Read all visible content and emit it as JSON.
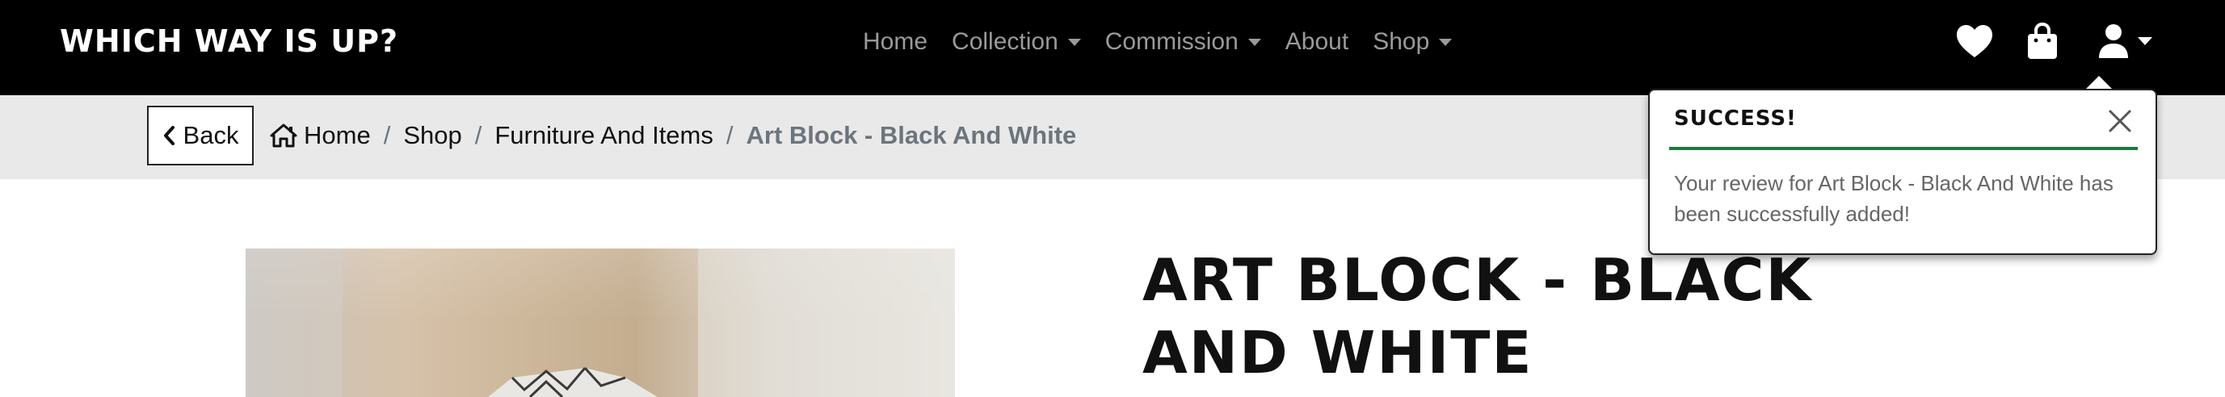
{
  "brand": "WHICH WAY IS UP?",
  "nav": {
    "items": [
      {
        "label": "Home"
      },
      {
        "label": "Collection"
      },
      {
        "label": "Commission"
      },
      {
        "label": "About"
      },
      {
        "label": "Shop"
      }
    ],
    "icons": [
      "heart-icon",
      "shopping-bag-icon",
      "user-icon"
    ]
  },
  "breadcrumb": {
    "back_label": "Back",
    "items": [
      "Home",
      "Shop",
      "Furniture And Items"
    ],
    "active": "Art Block - Black And White",
    "separator": "/"
  },
  "product": {
    "title": "Art Block - Black And White"
  },
  "toast": {
    "title": "Success!",
    "message": "Your review for Art Block - Black And White has been successfully added!",
    "accent_color": "#1e7a3f"
  }
}
